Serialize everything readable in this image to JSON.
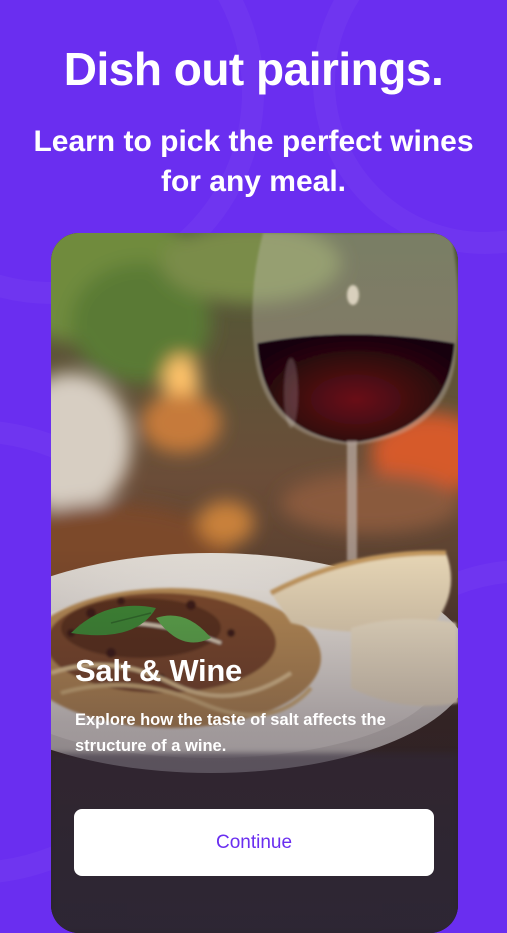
{
  "hero": {
    "headline": "Dish out pairings.",
    "subheadline": "Learn to pick the perfect wines for any meal."
  },
  "card": {
    "image_alt": "Glass of red wine beside a plate of pasta and bread",
    "title": "Salt & Wine",
    "description": "Explore how the taste of salt affects the structure of a wine.",
    "button_label": "Continue"
  },
  "colors": {
    "background": "#6a2ef0",
    "accent": "#6a2ef0",
    "button_bg": "#ffffff"
  }
}
